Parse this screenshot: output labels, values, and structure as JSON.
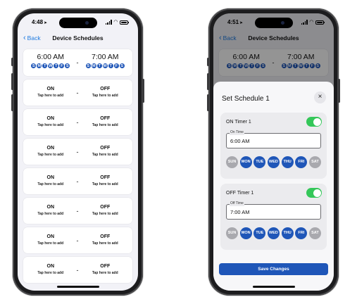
{
  "left_phone": {
    "status": {
      "time": "4:48"
    },
    "nav": {
      "back_label": "Back",
      "title": "Device Schedules"
    },
    "schedules": [
      {
        "on_time": "6:00 AM",
        "off_time": "7:00 AM",
        "on_days": [
          "S",
          "M",
          "T",
          "W",
          "T",
          "F",
          "S"
        ],
        "off_days": [
          "S",
          "M",
          "T",
          "W",
          "T",
          "F",
          "S"
        ]
      },
      {
        "on_label": "ON",
        "off_label": "OFF",
        "on_hint": "Tap here to add",
        "off_hint": "Tap here to add"
      },
      {
        "on_label": "ON",
        "off_label": "OFF",
        "on_hint": "Tap here to add",
        "off_hint": "Tap here to add"
      },
      {
        "on_label": "ON",
        "off_label": "OFF",
        "on_hint": "Tap here to add",
        "off_hint": "Tap here to add"
      },
      {
        "on_label": "ON",
        "off_label": "OFF",
        "on_hint": "Tap here to add",
        "off_hint": "Tap here to add"
      },
      {
        "on_label": "ON",
        "off_label": "OFF",
        "on_hint": "Tap here to add",
        "off_hint": "Tap here to add"
      },
      {
        "on_label": "ON",
        "off_label": "OFF",
        "on_hint": "Tap here to add",
        "off_hint": "Tap here to add"
      },
      {
        "on_label": "ON",
        "off_label": "OFF",
        "on_hint": "Tap here to add",
        "off_hint": "Tap here to add"
      }
    ],
    "separator": "-"
  },
  "right_phone": {
    "status": {
      "time": "4:51"
    },
    "nav": {
      "back_label": "Back",
      "title": "Device Schedules"
    },
    "bg_schedule": {
      "on_time": "6:00 AM",
      "off_time": "7:00 AM",
      "on_days": [
        "S",
        "M",
        "T",
        "W",
        "T",
        "F",
        "S"
      ],
      "off_days": [
        "S",
        "M",
        "T",
        "W",
        "T",
        "F",
        "S"
      ]
    },
    "sheet": {
      "title": "Set Schedule 1",
      "close_icon": "×",
      "on_timer": {
        "label": "ON Timer 1",
        "enabled": true,
        "field_label": "On Time",
        "value": "6:00 AM",
        "days": [
          {
            "label": "SUN",
            "selected": false
          },
          {
            "label": "MON",
            "selected": true
          },
          {
            "label": "TUE",
            "selected": true
          },
          {
            "label": "WED",
            "selected": true
          },
          {
            "label": "THU",
            "selected": true
          },
          {
            "label": "FRI",
            "selected": true
          },
          {
            "label": "SAT",
            "selected": false
          }
        ]
      },
      "off_timer": {
        "label": "OFF Timer 1",
        "enabled": true,
        "field_label": "Off Time",
        "value": "7:00 AM",
        "days": [
          {
            "label": "SUN",
            "selected": false
          },
          {
            "label": "MON",
            "selected": true
          },
          {
            "label": "TUE",
            "selected": true
          },
          {
            "label": "WED",
            "selected": true
          },
          {
            "label": "THU",
            "selected": true
          },
          {
            "label": "FRI",
            "selected": true
          },
          {
            "label": "SAT",
            "selected": false
          }
        ]
      },
      "save_label": "Save Changes"
    }
  },
  "colors": {
    "accent": "#1f56b8",
    "link": "#1e7ae0",
    "toggle_on": "#34c759",
    "day_off": "#a9a9ae"
  }
}
